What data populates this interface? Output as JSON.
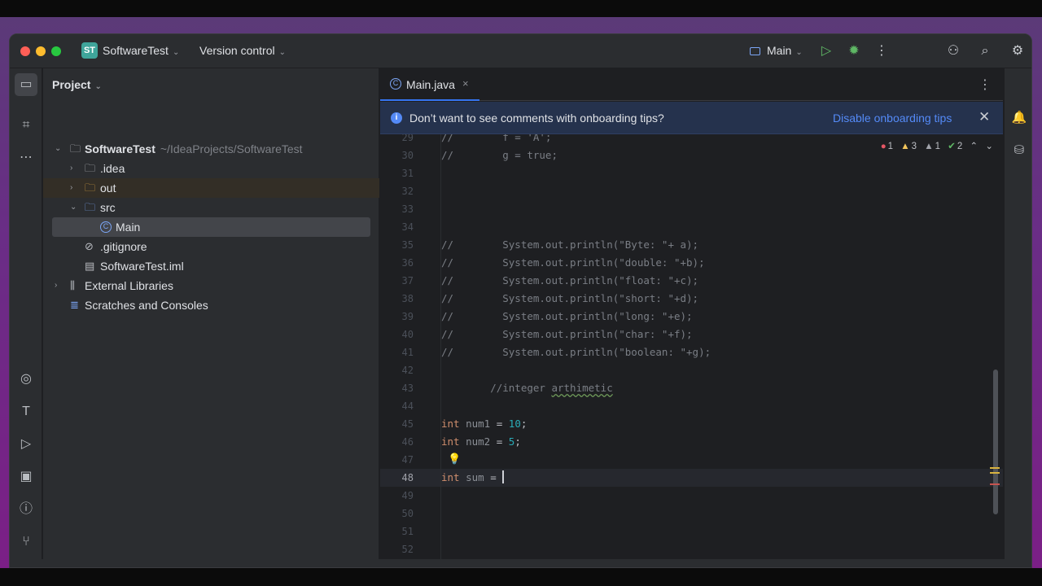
{
  "window": {
    "project_badge": "ST",
    "project_name": "SoftwareTest",
    "vcs_label": "Version control",
    "run_config": "Main"
  },
  "project_panel": {
    "title": "Project",
    "tree": [
      {
        "label": "SoftwareTest",
        "path": "~/IdeaProjects/SoftwareTest",
        "icon": "module-folder-icon"
      },
      {
        "label": ".idea",
        "icon": "folder-icon"
      },
      {
        "label": "out",
        "icon": "folder-icon"
      },
      {
        "label": "src",
        "icon": "source-folder-icon"
      },
      {
        "label": "Main",
        "icon": "class-icon"
      },
      {
        "label": ".gitignore",
        "icon": "ignore-file-icon"
      },
      {
        "label": "SoftwareTest.iml",
        "icon": "module-file-icon"
      },
      {
        "label": "External Libraries",
        "icon": "library-icon"
      },
      {
        "label": "Scratches and Consoles",
        "icon": "scratches-icon"
      }
    ]
  },
  "editor": {
    "tab_label": "Main.java",
    "tab_icon": "C",
    "banner": {
      "text": "Don’t want to see comments with onboarding tips?",
      "link": "Disable onboarding tips"
    },
    "inspections": {
      "errors": "1",
      "warnings": "3",
      "weak_warnings": "1",
      "ok": "2"
    },
    "lines": [
      {
        "n": "29",
        "parts": [
          {
            "t": "//        f = 'A';",
            "c": "cmt"
          }
        ]
      },
      {
        "n": "30",
        "parts": [
          {
            "t": "//        g = true;",
            "c": "cmt"
          }
        ]
      },
      {
        "n": "31",
        "parts": []
      },
      {
        "n": "32",
        "parts": []
      },
      {
        "n": "33",
        "parts": []
      },
      {
        "n": "34",
        "parts": []
      },
      {
        "n": "35",
        "parts": [
          {
            "t": "//        System.out.println(\"Byte: \"+ a);",
            "c": "cmt"
          }
        ]
      },
      {
        "n": "36",
        "parts": [
          {
            "t": "//        System.out.println(\"double: \"+b);",
            "c": "cmt"
          }
        ]
      },
      {
        "n": "37",
        "parts": [
          {
            "t": "//        System.out.println(\"float: \"+c);",
            "c": "cmt"
          }
        ]
      },
      {
        "n": "38",
        "parts": [
          {
            "t": "//        System.out.println(\"short: \"+d);",
            "c": "cmt"
          }
        ]
      },
      {
        "n": "39",
        "parts": [
          {
            "t": "//        System.out.println(\"long: \"+e);",
            "c": "cmt"
          }
        ]
      },
      {
        "n": "40",
        "parts": [
          {
            "t": "//        System.out.println(\"char: \"+f);",
            "c": "cmt"
          }
        ]
      },
      {
        "n": "41",
        "parts": [
          {
            "t": "//        System.out.println(\"boolean: \"+g);",
            "c": "cmt"
          }
        ]
      },
      {
        "n": "42",
        "parts": []
      },
      {
        "n": "43",
        "parts": [
          {
            "t": "        //integer ",
            "c": "cmt"
          },
          {
            "t": "arthimetic",
            "c": "cmt typo"
          }
        ]
      },
      {
        "n": "44",
        "parts": []
      },
      {
        "n": "45",
        "parts": [
          {
            "t": "int",
            "c": "kw"
          },
          {
            "t": " num1",
            "c": "var"
          },
          {
            "t": " = ",
            "c": ""
          },
          {
            "t": "10",
            "c": "num"
          },
          {
            "t": ";",
            "c": ""
          }
        ]
      },
      {
        "n": "46",
        "parts": [
          {
            "t": "int",
            "c": "kw"
          },
          {
            "t": " num2",
            "c": "var"
          },
          {
            "t": " = ",
            "c": ""
          },
          {
            "t": "5",
            "c": "num"
          },
          {
            "t": ";",
            "c": ""
          }
        ]
      },
      {
        "n": "47",
        "parts": [],
        "bulb": true
      },
      {
        "n": "48",
        "parts": [
          {
            "t": "int",
            "c": "kw"
          },
          {
            "t": " sum",
            "c": "var"
          },
          {
            "t": " = ",
            "c": ""
          }
        ],
        "current": true
      },
      {
        "n": "49",
        "parts": []
      },
      {
        "n": "50",
        "parts": []
      },
      {
        "n": "51",
        "parts": []
      },
      {
        "n": "52",
        "parts": []
      }
    ]
  },
  "colors": {
    "accent": "#3574f0",
    "keyword": "#cf8e6d",
    "number": "#2aacb8",
    "comment": "#7a7e85",
    "banner_bg": "#25324d"
  }
}
